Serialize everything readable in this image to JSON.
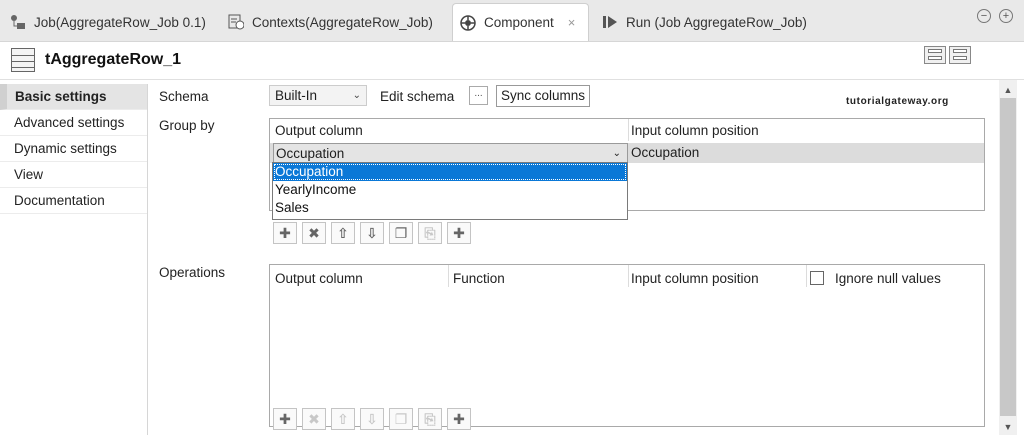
{
  "tabs": [
    {
      "label": "Job(AggregateRow_Job 0.1)"
    },
    {
      "label": "Contexts(AggregateRow_Job)"
    },
    {
      "label": "Component"
    },
    {
      "label": "Run (Job AggregateRow_Job)"
    }
  ],
  "tab_close": "×",
  "window_buttons": {
    "minimize": "−",
    "maximize": "+"
  },
  "component": {
    "title": "tAggregateRow_1"
  },
  "sidenav": {
    "items": [
      {
        "label": "Basic settings"
      },
      {
        "label": "Advanced settings"
      },
      {
        "label": "Dynamic settings"
      },
      {
        "label": "View"
      },
      {
        "label": "Documentation"
      }
    ]
  },
  "schema": {
    "label": "Schema",
    "value": "Built-In",
    "arrow": "⌄",
    "edit_label": "Edit schema",
    "ellipsis": "...",
    "sync_label": "Sync columns"
  },
  "watermark": "tutorialgateway.org",
  "group_by": {
    "label": "Group by",
    "headers": [
      "Output column",
      "Input column position"
    ],
    "row": {
      "output": "Occupation",
      "input": "Occupation"
    },
    "arrow": "⌄",
    "dropdown_options": [
      "Occupation",
      "YearlyIncome",
      "Sales"
    ],
    "dropdown_selected": "Occupation"
  },
  "operations": {
    "label": "Operations",
    "headers": [
      "Output column",
      "Function",
      "Input column position"
    ],
    "ignore_null_label": "Ignore null values",
    "ignore_null_checked": false
  },
  "toolbar": {
    "icons": [
      "add-icon",
      "remove-icon",
      "move-up-icon",
      "move-down-icon",
      "copy-icon",
      "paste-icon",
      "import-icon"
    ],
    "glyphs": [
      "✚",
      "✖",
      "⇧",
      "⇩",
      "❐",
      "⎘",
      "✚"
    ]
  },
  "scrollbar": {
    "up": "▲",
    "down": "▼"
  }
}
